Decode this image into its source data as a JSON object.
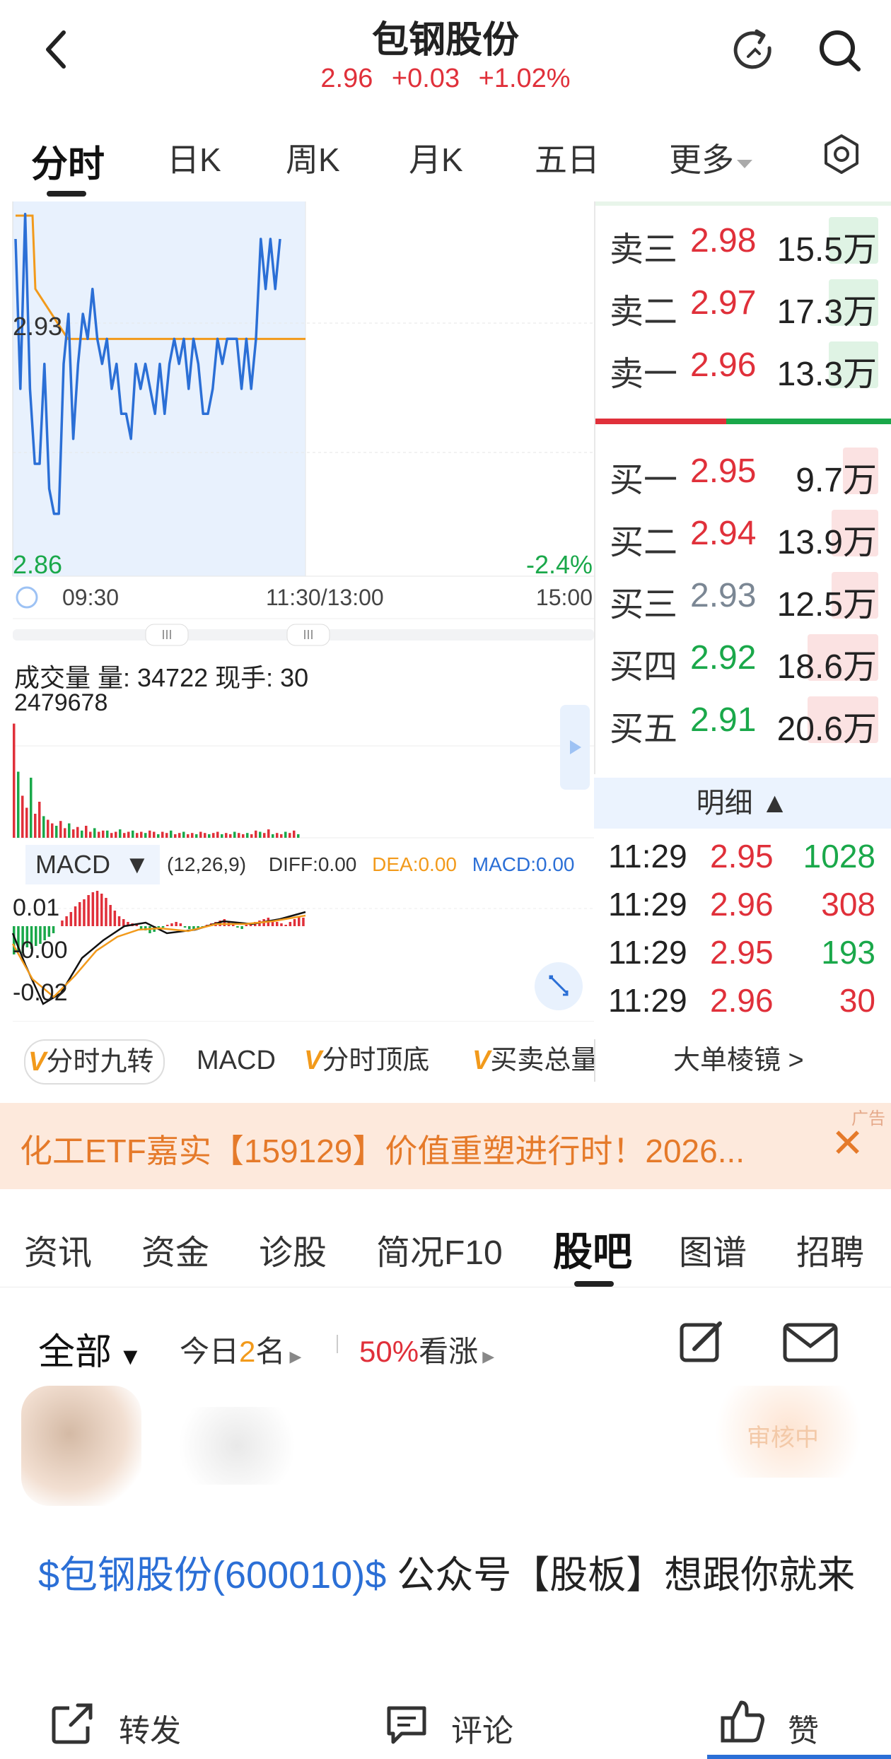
{
  "header": {
    "title": "包钢股份",
    "price": "2.96",
    "change": "+0.03",
    "change_pct": "+1.02%"
  },
  "tabs": [
    {
      "label": "分时",
      "active": true
    },
    {
      "label": "日K"
    },
    {
      "label": "周K"
    },
    {
      "label": "月K"
    },
    {
      "label": "五日"
    },
    {
      "label": "更多"
    }
  ],
  "intraday": {
    "price_high_label": "2.93",
    "price_low_label": "2.86",
    "pct_low_label": "-2.4%",
    "time_start": "09:30",
    "time_mid": "11:30/13:00",
    "time_end": "15:00",
    "price_scale": [
      2.855,
      3.005
    ],
    "avg_price": 2.95
  },
  "volume": {
    "label": "成交量 量: 34722 现手: 30",
    "max_label": "2479678"
  },
  "macd": {
    "name": "MACD",
    "params": "(12,26,9)",
    "diff": "DIFF:0.00",
    "dea": "DEA:0.00",
    "macd": "MACD:0.00",
    "y_top": "0.01",
    "y_mid": "-0.00",
    "y_bot": "-0.02"
  },
  "order_book": {
    "asks": [
      {
        "label": "卖三",
        "price": "2.98",
        "vol": "15.5万",
        "level": 0.28
      },
      {
        "label": "卖二",
        "price": "2.97",
        "vol": "17.3万",
        "level": 0.28
      },
      {
        "label": "卖一",
        "price": "2.96",
        "vol": "13.3万",
        "level": 0.28
      }
    ],
    "bids": [
      {
        "label": "买一",
        "price": "2.95",
        "vol": "9.7万",
        "level": 0.2
      },
      {
        "label": "买二",
        "price": "2.94",
        "vol": "13.9万",
        "level": 0.26
      },
      {
        "label": "买三",
        "price": "2.93",
        "vol": "12.5万",
        "level": 0.26
      },
      {
        "label": "买四",
        "price": "2.92",
        "vol": "18.6万",
        "level": 0.46
      },
      {
        "label": "买五",
        "price": "2.91",
        "vol": "20.6万",
        "level": 0.46
      }
    ]
  },
  "detail": {
    "label": "明细 ▲",
    "ticks": [
      {
        "time": "11:29",
        "price": "2.95",
        "vol": "1028",
        "vol_color": "green"
      },
      {
        "time": "11:29",
        "price": "2.96",
        "vol": "308",
        "vol_color": "red"
      },
      {
        "time": "11:29",
        "price": "2.95",
        "vol": "193",
        "vol_color": "green"
      },
      {
        "time": "11:29",
        "price": "2.96",
        "vol": "30",
        "vol_color": "red"
      }
    ]
  },
  "indicators": {
    "nine": "分时九转",
    "macd": "MACD",
    "top_bottom": "分时顶底",
    "total": "买卖总量",
    "big_order": "大单棱镜 >"
  },
  "ad": {
    "text": "化工ETF嘉实【159129】价值重塑进行时！2026...",
    "tag": "广告",
    "close": "✕"
  },
  "section_tabs": [
    "资讯",
    "资金",
    "诊股",
    "简况F10",
    "股吧",
    "图谱",
    "招聘"
  ],
  "filter": {
    "scope": "全部",
    "today_prefix": "今日",
    "today_count": "2",
    "today_suffix": "名",
    "bull_pct": "50%",
    "bull_label": "看涨"
  },
  "post": {
    "status": "审核中",
    "link": "$包钢股份(600010)$",
    "body": " 公众号【股板】想跟你就来"
  },
  "bottom_bar": {
    "share": "转发",
    "comment": "评论",
    "like": "赞"
  },
  "colors": {
    "red": "#e0303a",
    "green": "#1aa84a",
    "blue": "#2b6fd6",
    "orange": "#f29a1b"
  }
}
